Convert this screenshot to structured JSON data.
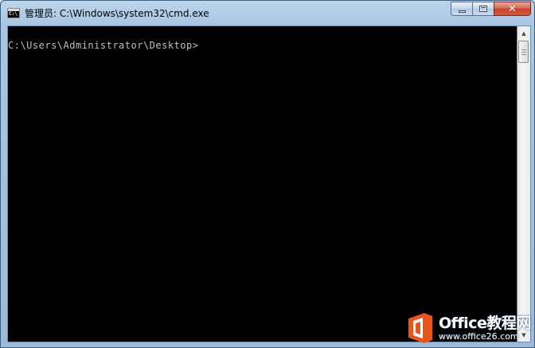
{
  "window": {
    "title": "管理员: C:\\Windows\\system32\\cmd.exe",
    "icon": "cmd-icon",
    "icon_text": "C:\\"
  },
  "caption": {
    "minimize_icon": "minimize-icon",
    "maximize_icon": "maximize-icon",
    "close_icon": "close-icon",
    "close_glyph": "✕"
  },
  "console": {
    "lines": [
      "C:\\Users\\Administrator\\Desktop>"
    ],
    "text_color": "#c0c0c0",
    "background": "#000000"
  },
  "scrollbar": {
    "up_glyph": "▲",
    "down_glyph": "▼"
  },
  "watermark": {
    "line1": "Office教程网",
    "line2": "www.office26.com",
    "logo_color": "#e8541e"
  }
}
